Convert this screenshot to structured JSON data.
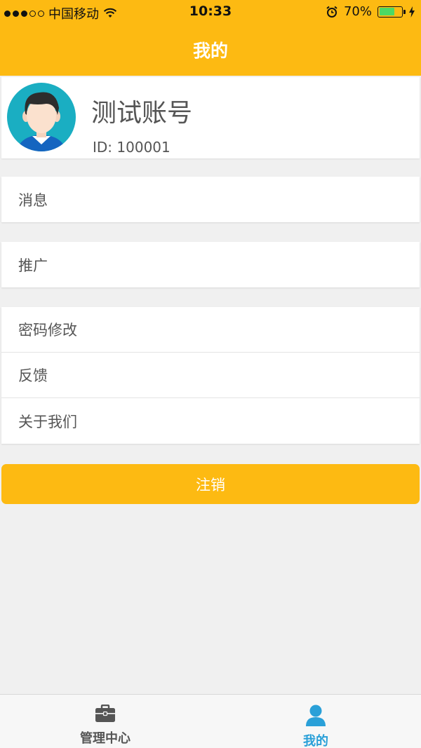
{
  "status_bar": {
    "carrier": "中国移动",
    "time": "10:33",
    "battery_percent": "70%",
    "battery_level": 0.7,
    "signal_filled": 3,
    "signal_total": 5
  },
  "navbar": {
    "title": "我的"
  },
  "profile": {
    "username": "测试账号",
    "user_id": "ID: 100001"
  },
  "menu_groups": [
    {
      "items": [
        {
          "label": "消息"
        }
      ]
    },
    {
      "items": [
        {
          "label": "推广"
        }
      ]
    },
    {
      "items": [
        {
          "label": "密码修改"
        },
        {
          "label": "反馈"
        },
        {
          "label": "关于我们"
        }
      ]
    }
  ],
  "logout_label": "注销",
  "tabbar": {
    "tabs": [
      {
        "label": "管理中心",
        "icon": "briefcase-icon",
        "active": false
      },
      {
        "label": "我的",
        "icon": "user-icon",
        "active": true
      }
    ]
  },
  "colors": {
    "primary": "#fdba12",
    "active_tab": "#2aa0d8",
    "background": "#f0f0f0"
  }
}
